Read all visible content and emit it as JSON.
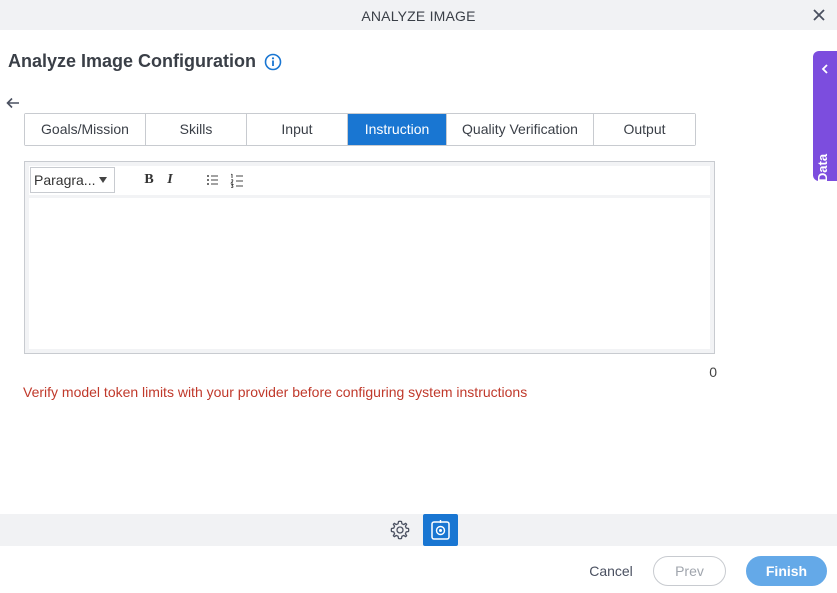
{
  "window": {
    "title": "ANALYZE IMAGE"
  },
  "page": {
    "heading": "Analyze Image Configuration"
  },
  "side_panel": {
    "label": "App Data"
  },
  "tabs": [
    {
      "label": "Goals/Mission",
      "active": false
    },
    {
      "label": "Skills",
      "active": false
    },
    {
      "label": "Input",
      "active": false
    },
    {
      "label": "Instruction",
      "active": true
    },
    {
      "label": "Quality Verification",
      "active": false
    },
    {
      "label": "Output",
      "active": false
    }
  ],
  "editor": {
    "paragraph_format": "Paragra...",
    "bold_label": "B",
    "italic_label": "I",
    "content": "",
    "char_count": "0"
  },
  "warning": "Verify model token limits with your provider before configuring system instructions",
  "footer": {
    "cancel_label": "Cancel",
    "prev_label": "Prev",
    "finish_label": "Finish"
  },
  "icons": {
    "close": "close-icon",
    "info": "info-icon",
    "back": "back-arrow-icon",
    "collapse": "chevron-left-icon",
    "settings": "gear-icon",
    "ai": "ai-image-icon"
  },
  "colors": {
    "accent": "#1976d2",
    "app_data": "#7c4dde",
    "warning": "#c0392b",
    "finish": "#64a9e8"
  }
}
